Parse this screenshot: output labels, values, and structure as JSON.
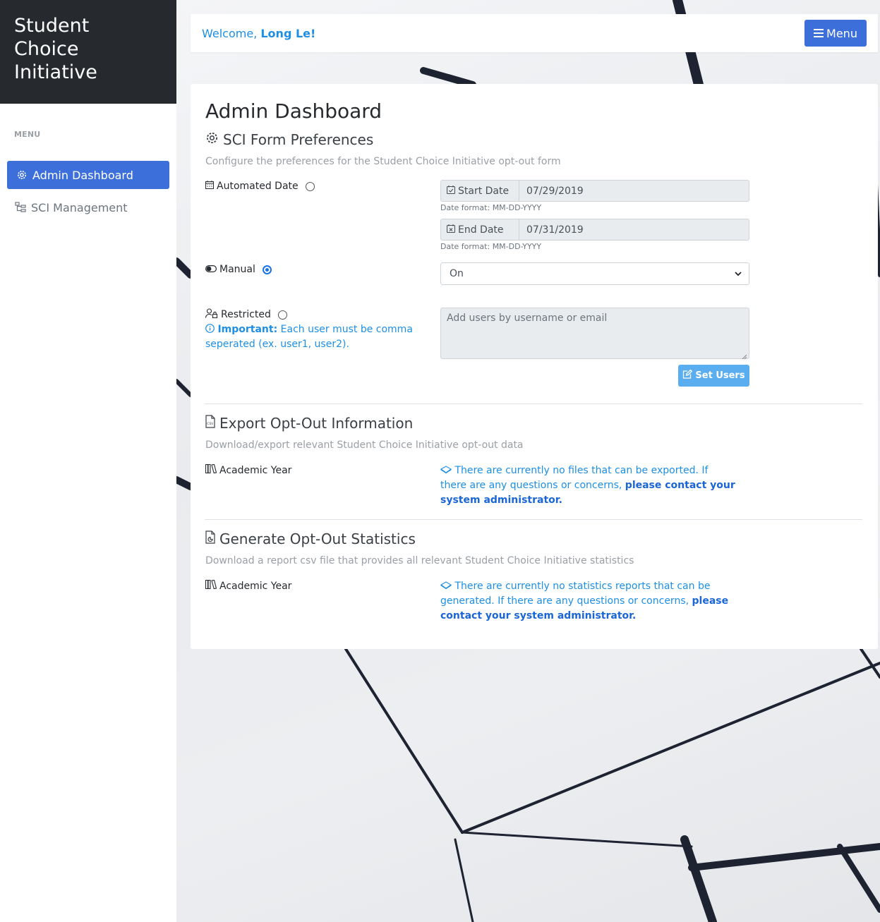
{
  "sidebar": {
    "brand": "Student\nChoice\nInitiative",
    "menu_label": "MENU",
    "items": [
      {
        "label": "Admin Dashboard",
        "icon": "gear-icon",
        "active": true
      },
      {
        "label": "SCI Management",
        "icon": "sitemap-icon",
        "active": false
      }
    ]
  },
  "topbar": {
    "welcome_prefix": "Welcome, ",
    "user_name": "Long Le!",
    "menu_label": "Menu"
  },
  "main": {
    "title": "Admin Dashboard",
    "preferences": {
      "title": "SCI Form Preferences",
      "description": "Configure the preferences for the Student Choice Initiative opt-out form",
      "automated_label": "Automated Date",
      "start_label": "Start Date",
      "start_value": "07/29/2019",
      "end_label": "End Date",
      "end_value": "07/31/2019",
      "date_help": "Date format: MM-DD-YYYY",
      "manual_label": "Manual",
      "manual_select_value": "On",
      "restricted_label": "Restricted",
      "important_bold": "Important:",
      "important_text": " Each user must be comma seperated (ex. user1, user2).",
      "users_placeholder": "Add users by username or email",
      "set_users_label": "Set Users"
    },
    "export": {
      "title": "Export Opt-Out Information",
      "description": "Download/export relevant Student Choice Initiative opt-out data",
      "year_label": "Academic Year",
      "notice_text": " There are currently no files that can be exported. If there are any questions or concerns, ",
      "notice_link": "please contact your system administrator."
    },
    "statistics": {
      "title": "Generate Opt-Out Statistics",
      "description": "Download a report csv file that provides all relevant Student Choice Initiative statistics",
      "year_label": "Academic Year",
      "notice_text": " There are currently no statistics reports that can be generated. If there are any questions or concerns, ",
      "notice_link": "please contact your system administrator."
    }
  },
  "colors": {
    "accent": "#3d6fdb",
    "link": "#1e8fe5",
    "sidebar_header": "#26292e"
  }
}
